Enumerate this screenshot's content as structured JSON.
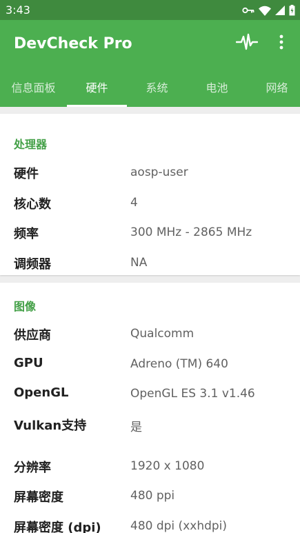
{
  "status_bar": {
    "time": "3:43",
    "icons": [
      "key-icon",
      "wifi-icon",
      "cellular-signal-icon",
      "battery-icon"
    ]
  },
  "app_bar": {
    "title": "DevCheck Pro",
    "actions": [
      "pulse-monitor-icon",
      "more-vert-icon"
    ],
    "color": "#4caf50"
  },
  "tabs": [
    {
      "label": "信息面板",
      "active": false
    },
    {
      "label": "硬件",
      "active": true
    },
    {
      "label": "系统",
      "active": false
    },
    {
      "label": "电池",
      "active": false
    },
    {
      "label": "网络",
      "active": false
    }
  ],
  "processor": {
    "title": "处理器",
    "rows": [
      {
        "label": "硬件",
        "value": "aosp-user"
      },
      {
        "label": "核心数",
        "value": "4"
      },
      {
        "label": "频率",
        "value": "300 MHz - 2865 MHz"
      },
      {
        "label": "调频器",
        "value": "NA"
      }
    ]
  },
  "graphics": {
    "title": "图像",
    "rows": [
      {
        "label": "供应商",
        "value": "Qualcomm"
      },
      {
        "label": "GPU",
        "value": "Adreno (TM) 640"
      },
      {
        "label": "OpenGL",
        "value": "OpenGL ES 3.1 v1.46"
      },
      {
        "label": "Vulkan支持",
        "value": "是"
      },
      {
        "label": "分辨率",
        "value": "1920 x 1080"
      },
      {
        "label": "屏幕密度",
        "value": "480 ppi"
      },
      {
        "label": "屏幕密度 (dpi)",
        "value": "480 dpi (xxhdpi)"
      }
    ]
  },
  "colors": {
    "status_bar": "#3f8a3e",
    "accent": "#43a047"
  }
}
